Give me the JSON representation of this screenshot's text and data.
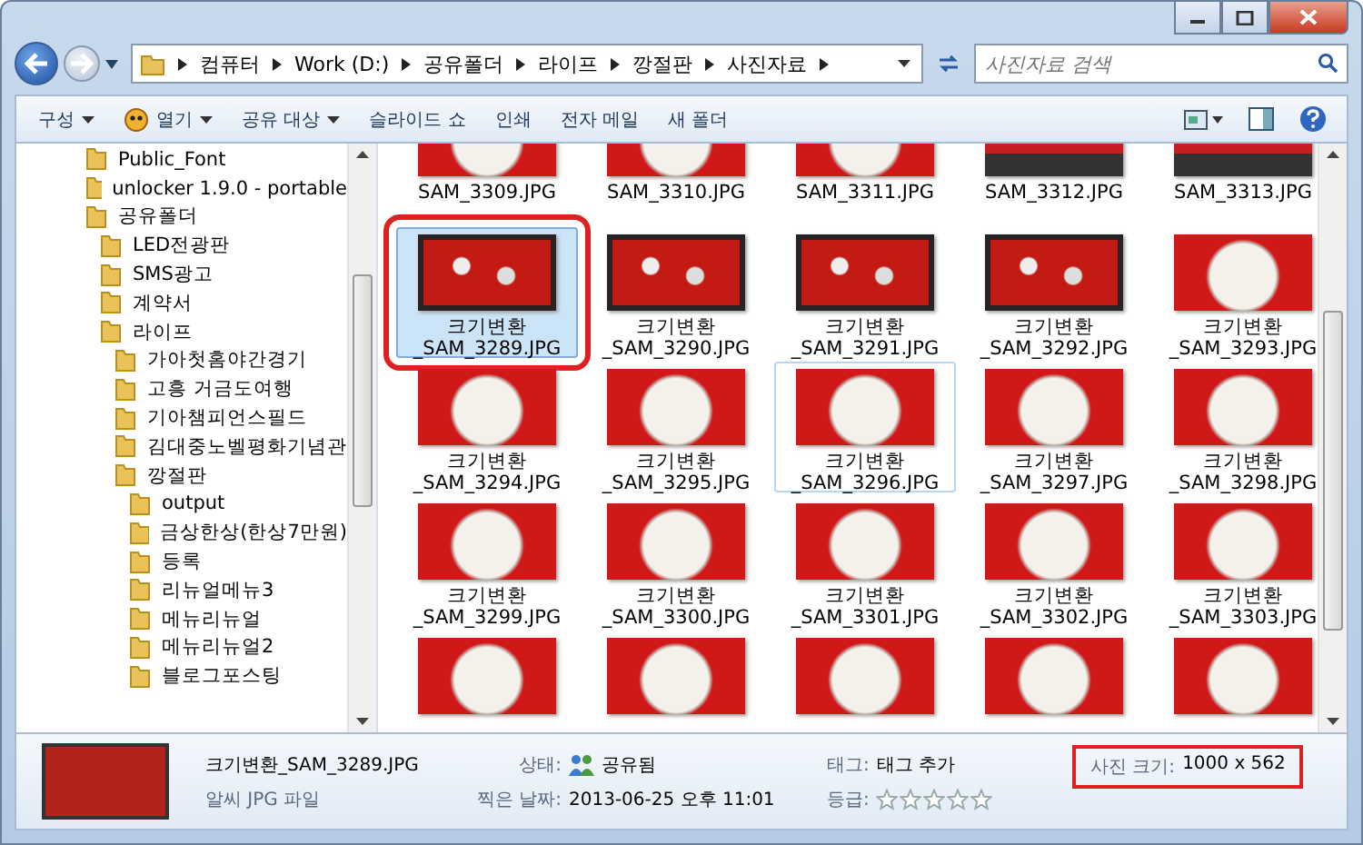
{
  "address": {
    "segments": [
      "컴퓨터",
      "Work (D:)",
      "공유폴더",
      "라이프",
      "깡절판",
      "사진자료"
    ],
    "search_placeholder": "사진자료 검색"
  },
  "toolbar": [
    {
      "label": "구성",
      "dropdown": true,
      "icon": false
    },
    {
      "label": "열기",
      "dropdown": true,
      "icon": true
    },
    {
      "label": "공유 대상",
      "dropdown": true,
      "icon": false
    },
    {
      "label": "슬라이드 쇼",
      "dropdown": false,
      "icon": false
    },
    {
      "label": "인쇄",
      "dropdown": false,
      "icon": false
    },
    {
      "label": "전자 메일",
      "dropdown": false,
      "icon": false
    },
    {
      "label": "새 폴더",
      "dropdown": false,
      "icon": false
    }
  ],
  "tree": [
    {
      "label": "Public_Font"
    },
    {
      "label": "unlocker 1.9.0 - portable"
    },
    {
      "label": "공유폴더",
      "children": [
        {
          "label": "LED전광판"
        },
        {
          "label": "SMS광고"
        },
        {
          "label": "계약서"
        },
        {
          "label": "라이프",
          "children": [
            {
              "label": "가아첫홈야간경기"
            },
            {
              "label": "고흥 거금도여행"
            },
            {
              "label": "기아챔피언스필드"
            },
            {
              "label": "김대중노벨평화기념관"
            },
            {
              "label": "깡절판",
              "children": [
                {
                  "label": "output"
                },
                {
                  "label": "금상한상(한상7만원)"
                },
                {
                  "label": "등록"
                },
                {
                  "label": "리뉴얼메뉴3"
                },
                {
                  "label": "메뉴리뉴얼"
                },
                {
                  "label": "메뉴리뉴얼2"
                },
                {
                  "label": "블로그포스팅"
                }
              ]
            }
          ]
        }
      ]
    }
  ],
  "files": [
    {
      "name": [
        "SAM_3309.JPG"
      ],
      "selected": false,
      "focused": false,
      "marked": false,
      "kind": "plate"
    },
    {
      "name": [
        "SAM_3310.JPG"
      ],
      "selected": false,
      "focused": false,
      "marked": false,
      "kind": "plate"
    },
    {
      "name": [
        "SAM_3311.JPG"
      ],
      "selected": false,
      "focused": false,
      "marked": false,
      "kind": "plate"
    },
    {
      "name": [
        "SAM_3312.JPG"
      ],
      "selected": false,
      "focused": false,
      "marked": false,
      "kind": "storefront"
    },
    {
      "name": [
        "SAM_3313.JPG"
      ],
      "selected": false,
      "focused": false,
      "marked": false,
      "kind": "storefront"
    },
    {
      "name": [
        "크기변환",
        "_SAM_3289.JPG"
      ],
      "selected": true,
      "focused": false,
      "marked": true,
      "kind": "table"
    },
    {
      "name": [
        "크기변환",
        "_SAM_3290.JPG"
      ],
      "selected": false,
      "focused": false,
      "marked": false,
      "kind": "table"
    },
    {
      "name": [
        "크기변환",
        "_SAM_3291.JPG"
      ],
      "selected": false,
      "focused": false,
      "marked": false,
      "kind": "table"
    },
    {
      "name": [
        "크기변환",
        "_SAM_3292.JPG"
      ],
      "selected": false,
      "focused": false,
      "marked": false,
      "kind": "table"
    },
    {
      "name": [
        "크기변환",
        "_SAM_3293.JPG"
      ],
      "selected": false,
      "focused": false,
      "marked": false,
      "kind": "plate"
    },
    {
      "name": [
        "크기변환",
        "_SAM_3294.JPG"
      ],
      "selected": false,
      "focused": false,
      "marked": false,
      "kind": "plate"
    },
    {
      "name": [
        "크기변환",
        "_SAM_3295.JPG"
      ],
      "selected": false,
      "focused": false,
      "marked": false,
      "kind": "plate"
    },
    {
      "name": [
        "크기변환",
        "_SAM_3296.JPG"
      ],
      "selected": false,
      "focused": true,
      "marked": false,
      "kind": "plate"
    },
    {
      "name": [
        "크기변환",
        "_SAM_3297.JPG"
      ],
      "selected": false,
      "focused": false,
      "marked": false,
      "kind": "plate"
    },
    {
      "name": [
        "크기변환",
        "_SAM_3298.JPG"
      ],
      "selected": false,
      "focused": false,
      "marked": false,
      "kind": "plate"
    },
    {
      "name": [
        "크기변환",
        "_SAM_3299.JPG"
      ],
      "selected": false,
      "focused": false,
      "marked": false,
      "kind": "plate"
    },
    {
      "name": [
        "크기변환",
        "_SAM_3300.JPG"
      ],
      "selected": false,
      "focused": false,
      "marked": false,
      "kind": "plate"
    },
    {
      "name": [
        "크기변환",
        "_SAM_3301.JPG"
      ],
      "selected": false,
      "focused": false,
      "marked": false,
      "kind": "plate"
    },
    {
      "name": [
        "크기변환",
        "_SAM_3302.JPG"
      ],
      "selected": false,
      "focused": false,
      "marked": false,
      "kind": "plate"
    },
    {
      "name": [
        "크기변환",
        "_SAM_3303.JPG"
      ],
      "selected": false,
      "focused": false,
      "marked": false,
      "kind": "plate"
    },
    {
      "selected": false,
      "focused": false,
      "marked": false,
      "kind": "plate"
    },
    {
      "selected": false,
      "focused": false,
      "marked": false,
      "kind": "plate"
    },
    {
      "selected": false,
      "focused": false,
      "marked": false,
      "kind": "plate"
    },
    {
      "selected": false,
      "focused": false,
      "marked": false,
      "kind": "plate"
    },
    {
      "selected": false,
      "focused": false,
      "marked": false,
      "kind": "plate"
    }
  ],
  "details": {
    "filename": "크기변환_SAM_3289.JPG",
    "type": "알씨 JPG 파일",
    "fields": [
      {
        "label": "상태:",
        "value": "공유됨",
        "kind": "shared"
      },
      {
        "label": "태그:",
        "value": "태그 추가",
        "kind": "text"
      },
      {
        "label": "찍은 날짜:",
        "value": "2013-06-25 오후 11:01",
        "kind": "text"
      },
      {
        "label": "등급:",
        "stars": 0,
        "kind": "rating"
      }
    ],
    "size": {
      "label": "사진 크기:",
      "value": "1000 x 562",
      "marked": true
    }
  }
}
